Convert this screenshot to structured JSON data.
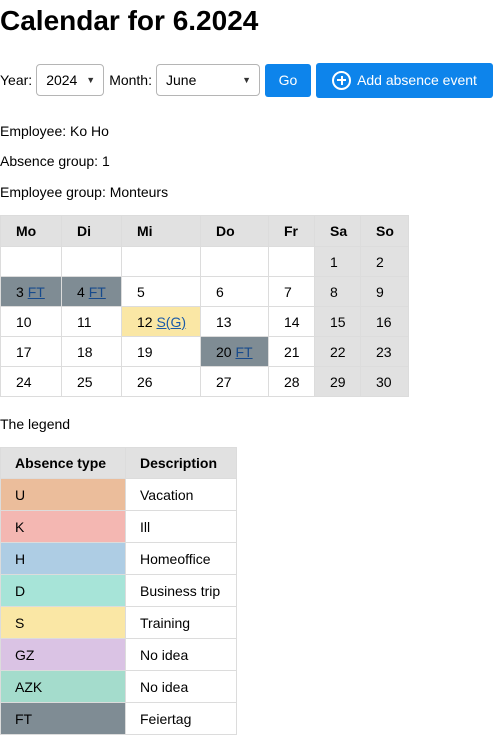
{
  "page_title": "Calendar for 6.2024",
  "controls": {
    "year_label": "Year:",
    "year_value": "2024",
    "month_label": "Month:",
    "month_value": "June",
    "go_label": "Go",
    "add_label": "Add absence event",
    "add_icon": "plus-circle-icon"
  },
  "info": {
    "employee": "Employee: Ko Ho",
    "absence_group": "Absence group: 1",
    "employee_group": "Employee group: Monteurs"
  },
  "calendar": {
    "headers": [
      "Mo",
      "Di",
      "Mi",
      "Do",
      "Fr",
      "Sa",
      "So"
    ],
    "weeks": [
      [
        "",
        "",
        "",
        "",
        "",
        "1",
        "2"
      ],
      [
        "3",
        "4",
        "5",
        "6",
        "7",
        "8",
        "9"
      ],
      [
        "10",
        "11",
        "12",
        "13",
        "14",
        "15",
        "16"
      ],
      [
        "17",
        "18",
        "19",
        "20",
        "21",
        "22",
        "23"
      ],
      [
        "24",
        "25",
        "26",
        "27",
        "28",
        "29",
        "30"
      ]
    ],
    "events": [
      {
        "day": "3",
        "code": "FT"
      },
      {
        "day": "4",
        "code": "FT"
      },
      {
        "day": "12",
        "code": "S(G)"
      },
      {
        "day": "20",
        "code": "FT"
      }
    ]
  },
  "legend": {
    "title": "The legend",
    "headers": [
      "Absence type",
      "Description"
    ],
    "rows": [
      {
        "type": "U",
        "description": "Vacation",
        "color": "#ebbd9b"
      },
      {
        "type": "K",
        "description": "Ill",
        "color": "#f4b7b2"
      },
      {
        "type": "H",
        "description": "Homeoffice",
        "color": "#aecde4"
      },
      {
        "type": "D",
        "description": "Business trip",
        "color": "#a7e4d8"
      },
      {
        "type": "S",
        "description": "Training",
        "color": "#fae7a5"
      },
      {
        "type": "GZ",
        "description": "No idea",
        "color": "#dac3e4"
      },
      {
        "type": "AZK",
        "description": "No idea",
        "color": "#a4dccc"
      },
      {
        "type": "FT",
        "description": "Feiertag",
        "color": "#7f8c94"
      }
    ]
  },
  "colors": {
    "accent": "#0d84eb",
    "weekend": "#e1e1e1",
    "holiday": "#7f8c94",
    "training": "#fae7a5",
    "link": "#1a5aa8"
  }
}
